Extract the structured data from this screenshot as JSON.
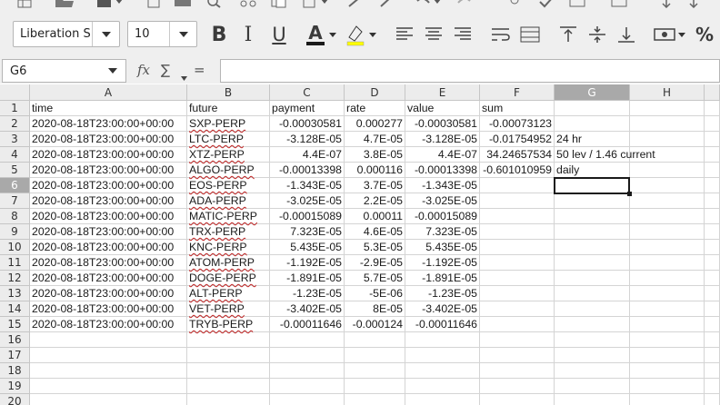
{
  "toolbar": {
    "font_name": "Liberation S",
    "font_size": "10",
    "bold_glyph": "B",
    "italic_glyph": "I",
    "underline_glyph": "U",
    "font_color_glyph": "A",
    "percent_glyph": "%",
    "colors": {
      "font_color": "#1a1a1a",
      "highlight": "#ffff00"
    },
    "icons": [
      "spreadsheet-icon",
      "open-icon",
      "save-icon",
      "export-pdf-icon",
      "print-icon",
      "preview-icon",
      "cut-icon",
      "copy-icon",
      "paste-icon",
      "clone-icon",
      "clear-icon",
      "undo-icon",
      "redo-icon",
      "find-replace-icon",
      "spelling-icon",
      "row-icon",
      "column-icon",
      "sort-ascending-icon",
      "sort-descending-icon"
    ]
  },
  "formula_bar": {
    "name_box": "G6",
    "fx": "fx",
    "sum": "∑",
    "equals": "=",
    "content": ""
  },
  "sheet": {
    "columns": [
      "A",
      "B",
      "C",
      "D",
      "E",
      "F",
      "G",
      "H"
    ],
    "row_numbers": [
      "1",
      "2",
      "3",
      "4",
      "5",
      "6",
      "7",
      "8",
      "9",
      "10",
      "11",
      "12",
      "13",
      "14",
      "15",
      "16",
      "17",
      "18",
      "19",
      "20"
    ],
    "selected_cell": "G6",
    "rows": [
      [
        "time",
        "future",
        "payment",
        "rate",
        "value",
        "sum",
        "",
        ""
      ],
      [
        "2020-08-18T23:00:00+00:00",
        "SXP-PERP",
        "-0.00030581",
        "0.000277",
        "-0.00030581",
        "-0.00073123",
        "",
        ""
      ],
      [
        "2020-08-18T23:00:00+00:00",
        "LTC-PERP",
        "-3.128E-05",
        "4.7E-05",
        "-3.128E-05",
        "-0.01754952",
        "24 hr",
        ""
      ],
      [
        "2020-08-18T23:00:00+00:00",
        "XTZ-PERP",
        "4.4E-07",
        "3.8E-05",
        "4.4E-07",
        "34.24657534",
        "50 lev / 1.46 current",
        ""
      ],
      [
        "2020-08-18T23:00:00+00:00",
        "ALGO-PERP",
        "-0.00013398",
        "0.000116",
        "-0.00013398",
        "-0.601010959",
        "daily",
        ""
      ],
      [
        "2020-08-18T23:00:00+00:00",
        "EOS-PERP",
        "-1.343E-05",
        "3.7E-05",
        "-1.343E-05",
        "",
        "",
        ""
      ],
      [
        "2020-08-18T23:00:00+00:00",
        "ADA-PERP",
        "-3.025E-05",
        "2.2E-05",
        "-3.025E-05",
        "",
        "",
        ""
      ],
      [
        "2020-08-18T23:00:00+00:00",
        "MATIC-PERP",
        "-0.00015089",
        "0.00011",
        "-0.00015089",
        "",
        "",
        ""
      ],
      [
        "2020-08-18T23:00:00+00:00",
        "TRX-PERP",
        "7.323E-05",
        "4.6E-05",
        "7.323E-05",
        "",
        "",
        ""
      ],
      [
        "2020-08-18T23:00:00+00:00",
        "KNC-PERP",
        "5.435E-05",
        "5.3E-05",
        "5.435E-05",
        "",
        "",
        ""
      ],
      [
        "2020-08-18T23:00:00+00:00",
        "ATOM-PERP",
        "-1.192E-05",
        "-2.9E-05",
        "-1.192E-05",
        "",
        "",
        ""
      ],
      [
        "2020-08-18T23:00:00+00:00",
        "DOGE-PERP",
        "-1.891E-05",
        "5.7E-05",
        "-1.891E-05",
        "",
        "",
        ""
      ],
      [
        "2020-08-18T23:00:00+00:00",
        "ALT-PERP",
        "-1.23E-05",
        "-5E-06",
        "-1.23E-05",
        "",
        "",
        ""
      ],
      [
        "2020-08-18T23:00:00+00:00",
        "VET-PERP",
        "-3.402E-05",
        "8E-05",
        "-3.402E-05",
        "",
        "",
        ""
      ],
      [
        "2020-08-18T23:00:00+00:00",
        "TRYB-PERP",
        "-0.00011646",
        "-0.000124",
        "-0.00011646",
        "",
        "",
        ""
      ],
      [
        "",
        "",
        "",
        "",
        "",
        "",
        "",
        ""
      ],
      [
        "",
        "",
        "",
        "",
        "",
        "",
        "",
        ""
      ],
      [
        "",
        "",
        "",
        "",
        "",
        "",
        "",
        ""
      ],
      [
        "",
        "",
        "",
        "",
        "",
        "",
        "",
        ""
      ],
      [
        "",
        "",
        "",
        "",
        "",
        "",
        "",
        ""
      ]
    ]
  }
}
